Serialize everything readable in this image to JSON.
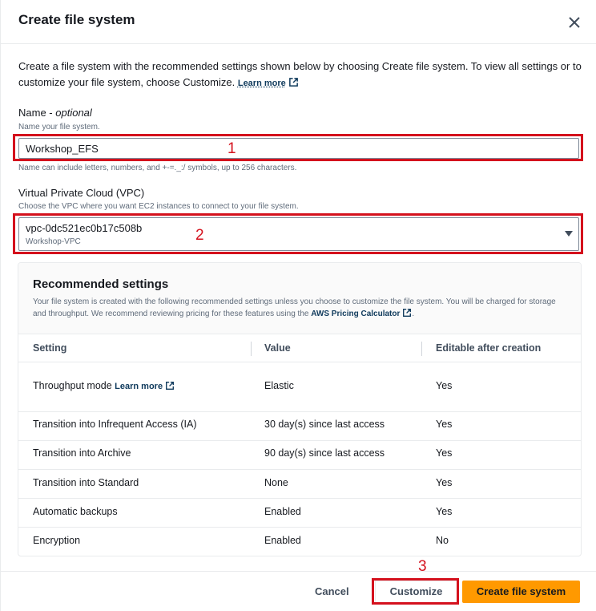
{
  "dialog": {
    "title": "Create file system",
    "intro": "Create a file system with the recommended settings shown below by choosing Create file system. To view all settings or to customize your file system, choose Customize.",
    "learn_more": "Learn more"
  },
  "name_field": {
    "label": "Name",
    "optional": "optional",
    "separator": " - ",
    "description": "Name your file system.",
    "value": "Workshop_EFS",
    "constraint": "Name can include letters, numbers, and +-=._:/ symbols, up to 256 characters."
  },
  "vpc_field": {
    "label": "Virtual Private Cloud (VPC)",
    "description": "Choose the VPC where you want EC2 instances to connect to your file system.",
    "selected_id": "vpc-0dc521ec0b17c508b",
    "selected_name": "Workshop-VPC"
  },
  "recommended": {
    "title": "Recommended settings",
    "description": "Your file system is created with the following recommended settings unless you choose to customize the file system. You will be charged for storage and throughput. We recommend reviewing pricing for these features using the",
    "calculator_link": "AWS Pricing Calculator",
    "columns": [
      "Setting",
      "Value",
      "Editable after creation"
    ],
    "rows": [
      {
        "setting": "Throughput mode",
        "link": "Learn more",
        "value": "Elastic",
        "editable": "Yes"
      },
      {
        "setting": "Transition into Infrequent Access (IA)",
        "value": "30 day(s) since last access",
        "editable": "Yes"
      },
      {
        "setting": "Transition into Archive",
        "value": "90 day(s) since last access",
        "editable": "Yes"
      },
      {
        "setting": "Transition into Standard",
        "value": "None",
        "editable": "Yes"
      },
      {
        "setting": "Automatic backups",
        "value": "Enabled",
        "editable": "Yes"
      },
      {
        "setting": "Encryption",
        "value": "Enabled",
        "editable": "No"
      }
    ]
  },
  "footer": {
    "cancel": "Cancel",
    "customize": "Customize",
    "create": "Create file system"
  },
  "annotations": [
    "1",
    "2",
    "3"
  ],
  "colors": {
    "accent": "#ff9900",
    "annotation": "#d4111d",
    "link": "#0f3a5c"
  }
}
